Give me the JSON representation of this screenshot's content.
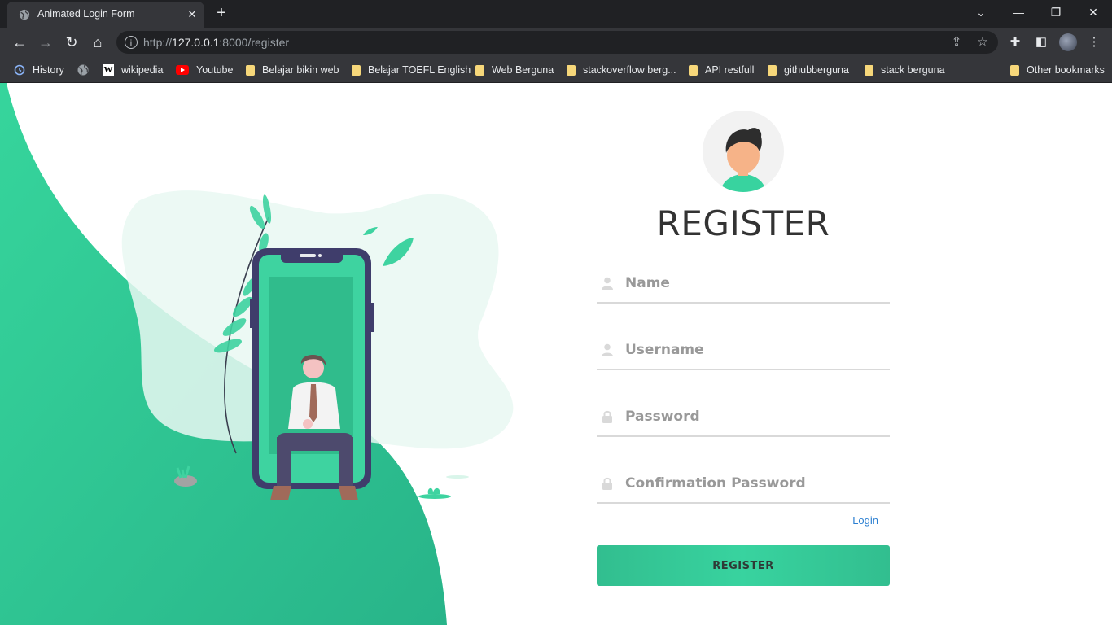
{
  "browser": {
    "tab_title": "Animated Login Form",
    "url_prefix": "http://",
    "url_host": "127.0.0.1",
    "url_rest": ":8000/register",
    "bookmarks": [
      {
        "label": "History",
        "icon": "history-icon"
      },
      {
        "label": "",
        "icon": "globe-icon"
      },
      {
        "label": "wikipedia",
        "icon": "wikipedia-icon"
      },
      {
        "label": "Youtube",
        "icon": "youtube-icon"
      },
      {
        "label": "Belajar bikin web",
        "icon": "folder-icon"
      },
      {
        "label": "Belajar TOEFL English",
        "icon": "folder-icon"
      },
      {
        "label": "Web Berguna",
        "icon": "folder-icon"
      },
      {
        "label": "stackoverflow berg...",
        "icon": "folder-icon"
      },
      {
        "label": "API restfull",
        "icon": "folder-icon"
      },
      {
        "label": "githubberguna",
        "icon": "folder-icon"
      },
      {
        "label": "stack berguna",
        "icon": "folder-icon"
      }
    ],
    "other_bookmarks": "Other bookmarks"
  },
  "form": {
    "title": "REGISTER",
    "fields": [
      {
        "label": "Name",
        "icon": "user-icon"
      },
      {
        "label": "Username",
        "icon": "user-icon"
      },
      {
        "label": "Password",
        "icon": "lock-icon"
      },
      {
        "label": "Confirmation Password",
        "icon": "lock-icon"
      }
    ],
    "login_link": "Login",
    "submit_label": "REGISTER"
  },
  "colors": {
    "accent": "#38d39f",
    "accent_dark": "#32be8f",
    "link": "#2b7fd1"
  }
}
